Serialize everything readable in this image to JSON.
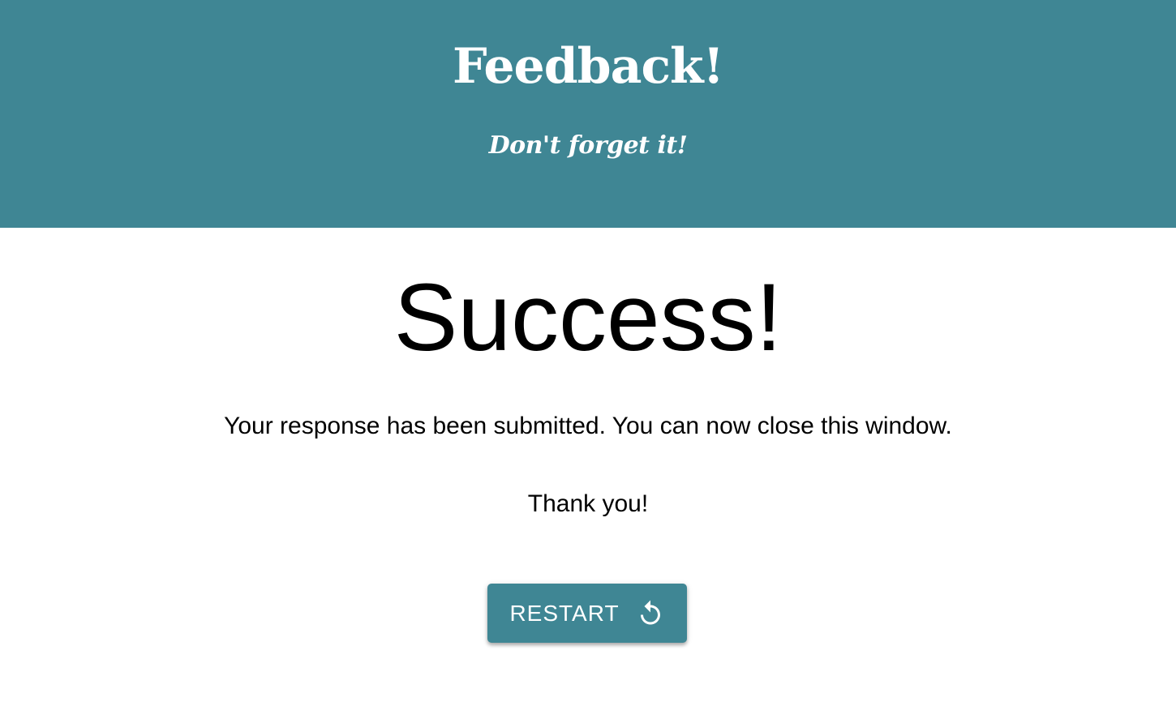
{
  "header": {
    "title": "Feedback!",
    "subtitle": "Don't forget it!",
    "background_color": "#3f8694"
  },
  "main": {
    "heading": "Success!",
    "message": "Your response has been submitted. You can now close this window.",
    "thanks": "Thank you!"
  },
  "restart_button": {
    "label": "RESTART",
    "icon": "restart-icon",
    "color": "#3f8694"
  }
}
